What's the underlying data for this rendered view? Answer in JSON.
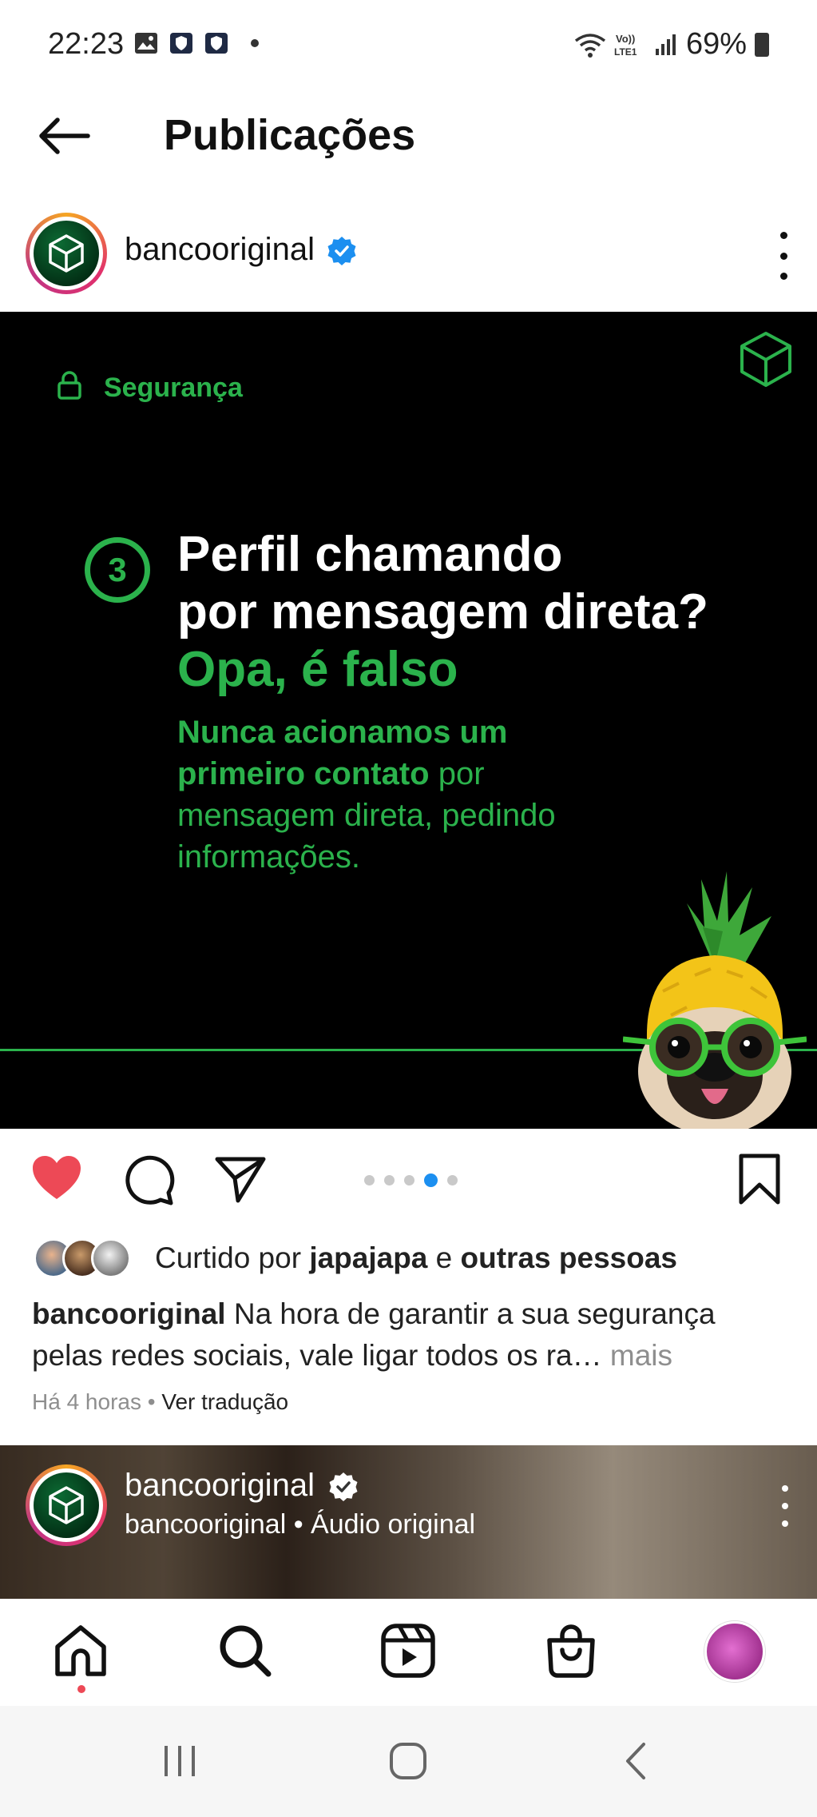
{
  "status_bar": {
    "time": "22:23",
    "battery": "69%",
    "network": "LTE1"
  },
  "header": {
    "title": "Publicações"
  },
  "post": {
    "username": "bancooriginal",
    "image": {
      "category": "Segurança",
      "number": "3",
      "headline_line1": "Perfil chamando",
      "headline_line2": "por mensagem direta?",
      "headline_line3": "Opa, é falso",
      "subtext_bold": "Nunca acionamos um primeiro contato",
      "subtext_rest": " por mensagem direta, pedindo informações."
    },
    "carousel": {
      "total": 5,
      "active_index": 3
    },
    "likes": {
      "prefix": "Curtido por ",
      "user": "japajapa",
      "middle": " e ",
      "others": "outras pessoas"
    },
    "caption": {
      "username": "bancooriginal",
      "text": " Na hora de garantir a sua segurança pelas redes sociais, vale ligar todos os ra…",
      "more": " mais"
    },
    "time_ago": "Há 4 horas",
    "separator": " • ",
    "translate": "Ver tradução"
  },
  "next_post": {
    "username": "bancooriginal",
    "audio": "bancooriginal • Áudio original"
  },
  "colors": {
    "brand_green": "#2bb24c",
    "like_red": "#ed4956",
    "verified_blue": "#1c8ff0"
  },
  "icons": {
    "back": "arrow-left-icon",
    "like": "heart-icon",
    "comment": "comment-icon",
    "share": "send-icon",
    "save": "bookmark-icon",
    "home": "home-icon",
    "search": "search-icon",
    "reels": "reels-icon",
    "shop": "shop-bag-icon"
  }
}
